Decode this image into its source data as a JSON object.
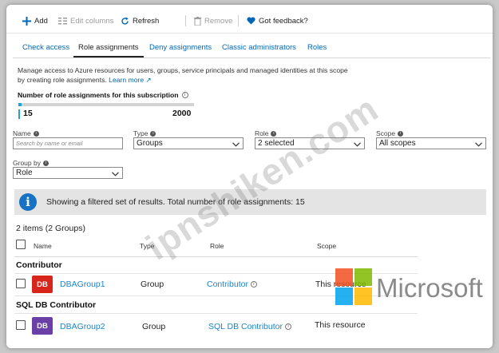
{
  "toolbar": {
    "add": "Add",
    "edit_columns": "Edit columns",
    "refresh": "Refresh",
    "remove": "Remove",
    "feedback": "Got feedback?"
  },
  "tabs": [
    {
      "label": "Check access",
      "active": false
    },
    {
      "label": "Role assignments",
      "active": true
    },
    {
      "label": "Deny assignments",
      "active": false
    },
    {
      "label": "Classic administrators",
      "active": false
    },
    {
      "label": "Roles",
      "active": false
    }
  ],
  "description": {
    "text": "Manage access to Azure resources for users, groups, service principals and managed identities at this scope by creating role assignments.",
    "learn_more": "Learn more"
  },
  "assignments": {
    "title": "Number of role assignments for this subscription",
    "current": "15",
    "max": "2000",
    "fraction": 0.0075
  },
  "filters": {
    "name_label": "Name",
    "name_placeholder": "Search by name or email",
    "type_label": "Type",
    "type_value": "Groups",
    "role_label": "Role",
    "role_value": "2 selected",
    "scope_label": "Scope",
    "scope_value": "All scopes",
    "group_by_label": "Group by",
    "group_by_value": "Role"
  },
  "banner": {
    "icon": "i",
    "text": "Showing a filtered set of results. Total number of role assignments: 15"
  },
  "items_count": "2 items (2 Groups)",
  "table": {
    "headers": [
      "Name",
      "Type",
      "Role",
      "Scope"
    ],
    "groups": [
      {
        "name": "Contributor",
        "rows": [
          {
            "initials": "DB",
            "name": "DBAGroup1",
            "type": "Group",
            "role": "Contributor",
            "scope": "This resource",
            "avatar_color": "#d9261c"
          }
        ]
      },
      {
        "name": "SQL DB Contributor",
        "rows": [
          {
            "initials": "DB",
            "name": "DBAGroup2",
            "type": "Group",
            "role": "SQL DB Contributor",
            "scope": "This resource",
            "avatar_color": "#6b3fa8"
          }
        ]
      }
    ]
  },
  "watermark": {
    "site": "ipnshiken.com",
    "brand": "Microsoft"
  },
  "colors": {
    "accent": "#0067b8",
    "link": "#1b86c8",
    "progress": "#1fa1d6",
    "info_badge": "#1572c4"
  }
}
